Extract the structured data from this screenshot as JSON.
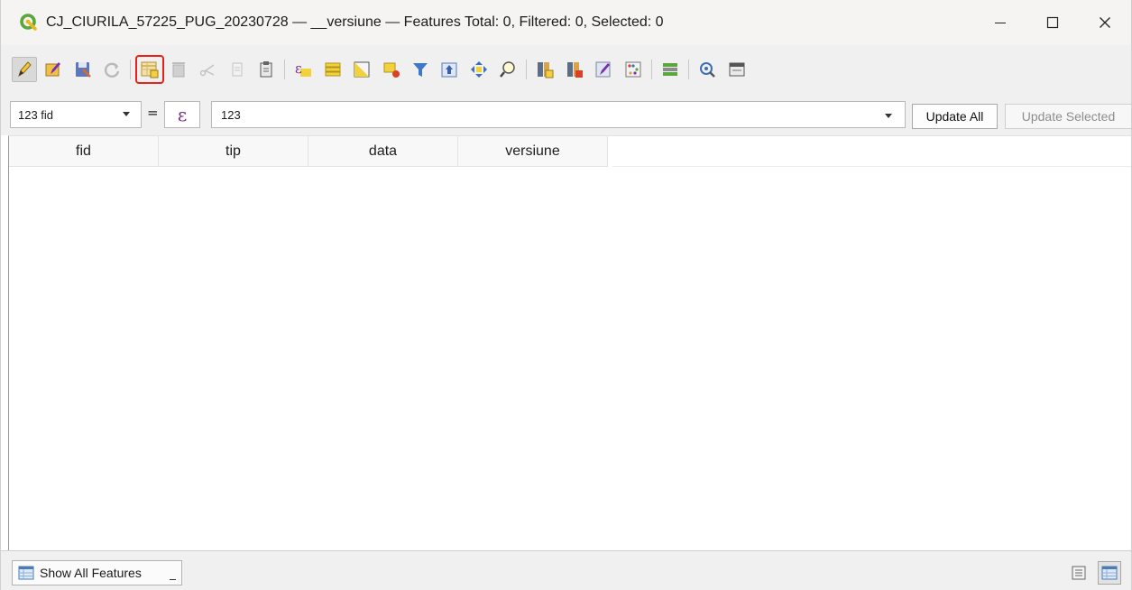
{
  "window": {
    "title": "CJ_CIURILA_57225_PUG_20230728 — __versiune — Features Total: 0, Filtered: 0, Selected: 0"
  },
  "toolbar": {
    "buttons": [
      {
        "name": "toggle-editing",
        "icon": "pencil-icon",
        "state": "active"
      },
      {
        "name": "multi-edit",
        "icon": "multi-edit-icon"
      },
      {
        "name": "save-edits",
        "icon": "save-icon"
      },
      {
        "name": "reload-table",
        "icon": "refresh-icon"
      },
      {
        "name": "add-feature",
        "icon": "add-feature-icon",
        "state": "highlighted"
      },
      {
        "name": "delete-selected",
        "icon": "trash-icon"
      },
      {
        "name": "cut",
        "icon": "scissors-icon"
      },
      {
        "name": "copy",
        "icon": "copy-icon"
      },
      {
        "name": "paste",
        "icon": "paste-icon"
      },
      {
        "name": "select-by-expression",
        "icon": "expression-select-icon"
      },
      {
        "name": "select-all",
        "icon": "select-all-icon"
      },
      {
        "name": "invert-selection",
        "icon": "invert-selection-icon"
      },
      {
        "name": "deselect-all",
        "icon": "deselect-icon"
      },
      {
        "name": "filter-select",
        "icon": "filter-icon"
      },
      {
        "name": "move-selection-top",
        "icon": "move-top-icon"
      },
      {
        "name": "pan-to-selected",
        "icon": "pan-icon"
      },
      {
        "name": "zoom-to-selected",
        "icon": "zoom-icon"
      },
      {
        "name": "new-field",
        "icon": "new-field-icon"
      },
      {
        "name": "delete-field",
        "icon": "delete-field-icon"
      },
      {
        "name": "field-calculator-toggle",
        "icon": "edit-field-icon"
      },
      {
        "name": "field-calculator",
        "icon": "abacus-icon"
      },
      {
        "name": "conditional-formatting",
        "icon": "conditional-format-icon"
      },
      {
        "name": "actions",
        "icon": "actions-icon"
      },
      {
        "name": "dock-table",
        "icon": "dock-icon"
      }
    ]
  },
  "calculator": {
    "field_label": "123 fid",
    "equals": "=",
    "epsilon": "ε",
    "expression_value": "123",
    "update_all": "Update All",
    "update_selected": "Update Selected"
  },
  "table": {
    "columns": [
      "fid",
      "tip",
      "data",
      "versiune"
    ],
    "rows": []
  },
  "bottom": {
    "show_features": "Show All Features"
  },
  "colors": {
    "accent_highlight": "#e8211b",
    "qgis_green": "#5aa83c",
    "expression_purple": "#7b2a87"
  }
}
